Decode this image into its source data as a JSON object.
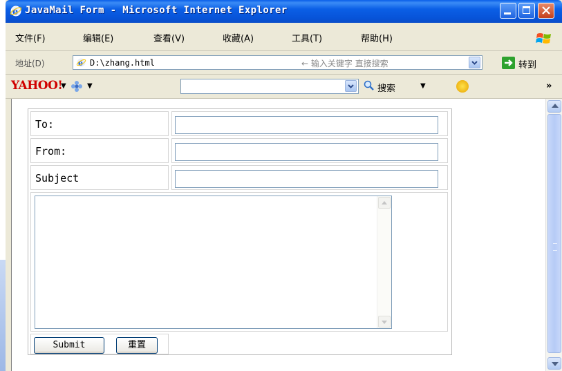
{
  "window": {
    "title": "JavaMail Form - Microsoft Internet Explorer",
    "controls": {
      "minimize_icon": "minimize-icon",
      "maximize_icon": "maximize-icon",
      "close_icon": "close-icon"
    },
    "title_color": "#0a5fe8"
  },
  "menu": {
    "items": [
      "文件(F)",
      "编辑(E)",
      "查看(V)",
      "收藏(A)",
      "工具(T)",
      "帮助(H)"
    ]
  },
  "address_bar": {
    "label": "地址(D)",
    "value": "D:\\zhang.html",
    "hint": "← 输入关键字 直接搜索",
    "go_label": "转到"
  },
  "yahoo_toolbar": {
    "logo": "YAHOO!",
    "search_value": "",
    "search_label": "搜索",
    "more": "»"
  },
  "form": {
    "to_label": "To:",
    "to_value": "",
    "from_label": "From:",
    "from_value": "",
    "subject_label": "Subject",
    "subject_value": "",
    "body_value": "",
    "submit_label": "Submit",
    "reset_label": "重置"
  },
  "colors": {
    "accent": "#0a5fe8",
    "chrome": "#ece9d8",
    "go_green": "#2ea22e",
    "yahoo_red": "#d00000"
  }
}
